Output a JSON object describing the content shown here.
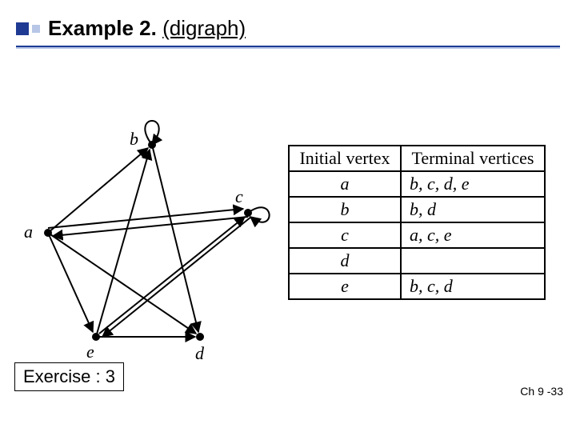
{
  "title": {
    "strong": "Example 2.",
    "rest": "(digraph)"
  },
  "graph": {
    "vertices": {
      "a": "a",
      "b": "b",
      "c": "c",
      "d": "d",
      "e": "e"
    }
  },
  "table": {
    "headers": {
      "left": "Initial vertex",
      "right": "Terminal vertices"
    },
    "rows": [
      {
        "v": "a",
        "adj": "b, c, d, e"
      },
      {
        "v": "b",
        "adj": "b, d"
      },
      {
        "v": "c",
        "adj": "a, c, e"
      },
      {
        "v": "d",
        "adj": ""
      },
      {
        "v": "e",
        "adj": "b, c, d"
      }
    ]
  },
  "exercise": "Exercise : 3",
  "footer": "Ch 9 -33"
}
